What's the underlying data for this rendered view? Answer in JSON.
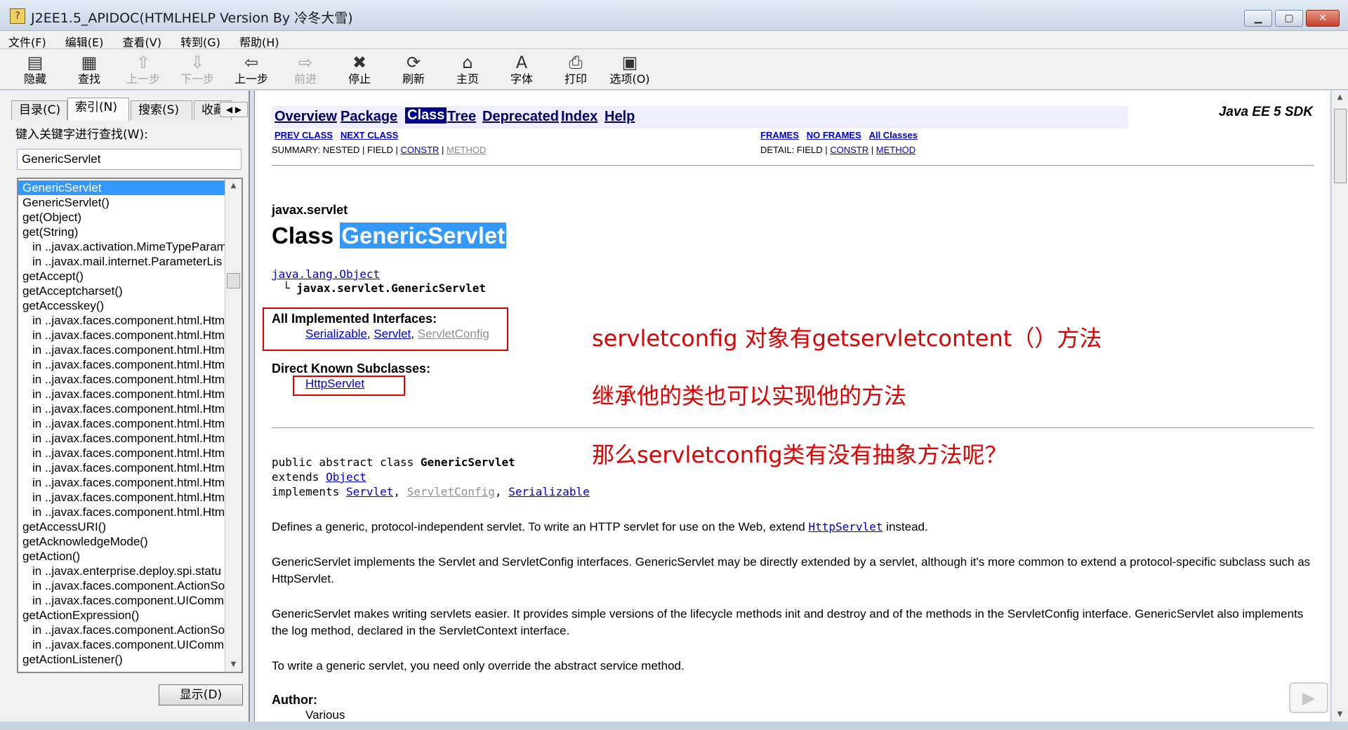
{
  "window": {
    "title": "J2EE1.5_APIDOC(HTMLHELP Version By 冷冬大雪)",
    "icon": "help-book-icon"
  },
  "menu": [
    "文件(F)",
    "编辑(E)",
    "查看(V)",
    "转到(G)",
    "帮助(H)"
  ],
  "toolbar": [
    {
      "label": "隐藏",
      "icon": "hide-icon",
      "enabled": true
    },
    {
      "label": "查找",
      "icon": "find-icon",
      "enabled": true
    },
    {
      "label": "上一步",
      "icon": "arrow-up-icon",
      "enabled": false
    },
    {
      "label": "下一步",
      "icon": "arrow-down-icon",
      "enabled": false
    },
    {
      "label": "上一步",
      "icon": "back-icon",
      "enabled": true
    },
    {
      "label": "前进",
      "icon": "forward-icon",
      "enabled": false
    },
    {
      "label": "停止",
      "icon": "stop-icon",
      "enabled": true
    },
    {
      "label": "刷新",
      "icon": "refresh-icon",
      "enabled": true
    },
    {
      "label": "主页",
      "icon": "home-icon",
      "enabled": true
    },
    {
      "label": "字体",
      "icon": "font-icon",
      "enabled": true
    },
    {
      "label": "打印",
      "icon": "print-icon",
      "enabled": true
    },
    {
      "label": "选项(O)",
      "icon": "options-icon",
      "enabled": true
    }
  ],
  "left": {
    "tabs": [
      "目录(C)",
      "索引(N)",
      "搜索(S)",
      "收藏"
    ],
    "search_label": "键入关键字进行查找(W):",
    "search_value": "GenericServlet",
    "display_button": "显示(D)",
    "items": [
      {
        "text": "GenericServlet",
        "sub": false,
        "selected": true
      },
      {
        "text": "GenericServlet()",
        "sub": false
      },
      {
        "text": "get(Object)",
        "sub": false
      },
      {
        "text": "get(String)",
        "sub": false
      },
      {
        "text": "in ..javax.activation.MimeTypeParam",
        "sub": true
      },
      {
        "text": "in ..javax.mail.internet.ParameterLis",
        "sub": true
      },
      {
        "text": "getAccept()",
        "sub": false
      },
      {
        "text": "getAcceptcharset()",
        "sub": false
      },
      {
        "text": "getAccesskey()",
        "sub": false
      },
      {
        "text": "in ..javax.faces.component.html.Htm",
        "sub": true
      },
      {
        "text": "in ..javax.faces.component.html.Htm",
        "sub": true
      },
      {
        "text": "in ..javax.faces.component.html.Htm",
        "sub": true
      },
      {
        "text": "in ..javax.faces.component.html.Htm",
        "sub": true
      },
      {
        "text": "in ..javax.faces.component.html.Htm",
        "sub": true
      },
      {
        "text": "in ..javax.faces.component.html.Htm",
        "sub": true
      },
      {
        "text": "in ..javax.faces.component.html.Htm",
        "sub": true
      },
      {
        "text": "in ..javax.faces.component.html.Htm",
        "sub": true
      },
      {
        "text": "in ..javax.faces.component.html.Htm",
        "sub": true
      },
      {
        "text": "in ..javax.faces.component.html.Htm",
        "sub": true
      },
      {
        "text": "in ..javax.faces.component.html.Htm",
        "sub": true
      },
      {
        "text": "in ..javax.faces.component.html.Htm",
        "sub": true
      },
      {
        "text": "in ..javax.faces.component.html.Htm",
        "sub": true
      },
      {
        "text": "in ..javax.faces.component.html.Htm",
        "sub": true
      },
      {
        "text": "getAccessURI()",
        "sub": false
      },
      {
        "text": "getAcknowledgeMode()",
        "sub": false
      },
      {
        "text": "getAction()",
        "sub": false
      },
      {
        "text": "in ..javax.enterprise.deploy.spi.statu",
        "sub": true
      },
      {
        "text": "in ..javax.faces.component.ActionSo",
        "sub": true
      },
      {
        "text": "in ..javax.faces.component.UIComm",
        "sub": true
      },
      {
        "text": "getActionExpression()",
        "sub": false
      },
      {
        "text": "in ..javax.faces.component.ActionSo",
        "sub": true
      },
      {
        "text": "in ..javax.faces.component.UIComm",
        "sub": true
      },
      {
        "text": "getActionListener()",
        "sub": false
      }
    ]
  },
  "doc": {
    "nav": [
      "Overview",
      "Package",
      "Class",
      "Tree",
      "Deprecated",
      "Index",
      "Help"
    ],
    "nav_current": "Class",
    "sdk_title": "Java EE 5 SDK",
    "prev_class": "PREV CLASS",
    "next_class": "NEXT CLASS",
    "frames": "FRAMES",
    "no_frames": "NO FRAMES",
    "all_classes": "All Classes",
    "summary_prefix": "SUMMARY: NESTED | FIELD |",
    "detail_prefix": "DETAIL: FIELD |",
    "constr": "CONSTR",
    "method": "METHOD",
    "sep": "|",
    "package": "javax.servlet",
    "class_word": "Class",
    "class_name": "GenericServlet",
    "hierarchy_root": "java.lang.Object",
    "hierarchy_child": "javax.servlet.GenericServlet",
    "hier_branch": "└",
    "impl_heading": "All Implemented Interfaces:",
    "impl_serializable": "Serializable",
    "impl_servlet": "Servlet",
    "impl_servletconfig": "ServletConfig",
    "comma": ",",
    "subclasses_heading": "Direct Known Subclasses:",
    "subclass": "HttpServlet",
    "decl_1": "public abstract class ",
    "decl_1b": "GenericServlet",
    "decl_2": "extends ",
    "decl_2b": "Object",
    "decl_3": "implements ",
    "decl_3a": "Servlet",
    "decl_3b": "ServletConfig",
    "decl_3c": "Serializable",
    "p1a": "Defines a generic, protocol-independent servlet. To write an HTTP servlet for use on the Web, extend ",
    "p1b": "HttpServlet",
    "p1c": " instead.",
    "p2": "GenericServlet implements the Servlet and ServletConfig interfaces. GenericServlet may be directly extended by a servlet, although it's more common to extend a protocol-specific subclass such as HttpServlet.",
    "p3": "GenericServlet makes writing servlets easier. It provides simple versions of the lifecycle methods init and destroy and of the methods in the ServletConfig interface. GenericServlet also implements the log method, declared in the ServletContext interface.",
    "p4": "To write a generic servlet, you need only override the abstract service method.",
    "author_heading": "Author:",
    "author_value": "Various"
  },
  "annotations": {
    "note1": "servletconfig   对象有getservletcontent（）方法",
    "note2": "继承他的类也可以实现他的方法",
    "note3": "那么servletconfig类有没有抽象方法呢？",
    "color": "#e00000"
  },
  "colors": {
    "selection": "#3399ff",
    "navbar_bg": "#eeeeff",
    "link": "#0000cc"
  }
}
